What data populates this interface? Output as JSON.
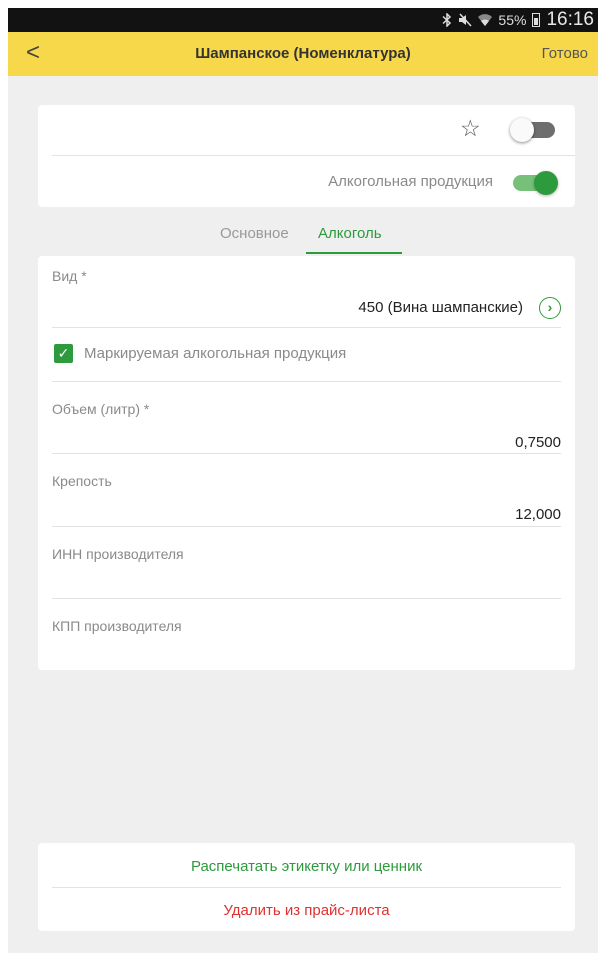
{
  "status_bar": {
    "battery": "55%",
    "time": "16:16"
  },
  "header": {
    "back_icon": "<",
    "title": "Шампанское (Номенклатура)",
    "done_label": "Готово"
  },
  "top_card": {
    "favorite_icon": "star-outline-icon",
    "toggle_1_on": false,
    "alcohol_label": "Алкогольная продукция",
    "alcohol_toggle_on": true
  },
  "tabs": [
    {
      "label": "Основное",
      "active": false
    },
    {
      "label": "Алкоголь",
      "active": true
    }
  ],
  "form": {
    "vid": {
      "label": "Вид *",
      "value": "450 (Вина шампанские)"
    },
    "marked_checkbox": {
      "label": "Маркируемая алкогольная продукция",
      "checked": true
    },
    "volume": {
      "label": "Объем (литр) *",
      "value": "0,7500"
    },
    "strength": {
      "label": "Крепость",
      "value": "12,000"
    },
    "producer_inn": {
      "label": "ИНН производителя",
      "value": ""
    },
    "producer_kpp": {
      "label": "КПП производителя",
      "value": ""
    }
  },
  "actions": {
    "print_label": "Распечатать этикетку или ценник",
    "delete_label": "Удалить из прайс-листа"
  },
  "colors": {
    "header_bg": "#f7d84a",
    "accent_green": "#2e9a3e",
    "danger_red": "#e03030"
  }
}
